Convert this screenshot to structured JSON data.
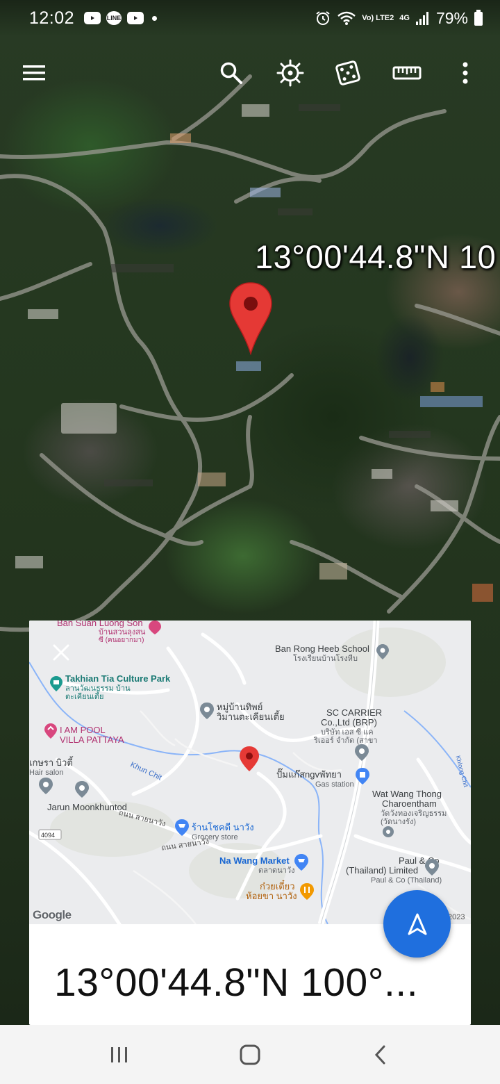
{
  "status_bar": {
    "time": "12:02",
    "notification_icons": [
      "youtube-icon",
      "line-icon",
      "youtube-icon"
    ],
    "battery_percent": "79%",
    "volte_label": "Vo) LTE2",
    "network_label": "4G"
  },
  "toolbar": {
    "icons": [
      "menu-icon",
      "search-icon",
      "voyager-wheel-icon",
      "feeling-lucky-dice-icon",
      "measure-ruler-icon",
      "more-options-icon"
    ]
  },
  "globe": {
    "coordinate_label": "13°00'44.8\"N 10"
  },
  "card": {
    "coordinate_title": "13°00'44.8\"N 100°...",
    "map": {
      "places": [
        {
          "name": "Ban Suan Luong Son",
          "type": "pink"
        },
        {
          "name": "บ้านสวนลุงสน",
          "type": "pink"
        },
        {
          "name": "ซี (คนอยากมา)",
          "type": "pink"
        },
        {
          "name": "Ban Rong Heeb School",
          "type": "dark"
        },
        {
          "name": "โรงเรียนบ้านโรงหีบ",
          "type": "small"
        },
        {
          "name": "Takhian Tia Culture Park",
          "type": "teal"
        },
        {
          "name": "ลานวัฒนธรรม บ้าน",
          "type": "teal-small"
        },
        {
          "name": "ตะเคียนเตี้ย",
          "type": "teal-small"
        },
        {
          "name": "หมู่บ้านทิพย์",
          "type": "dark"
        },
        {
          "name": "วิมานตะเคียนเตี้ย",
          "type": "dark"
        },
        {
          "name": "SC CARRIER",
          "type": "dark"
        },
        {
          "name": "Co.,Ltd (BRP)",
          "type": "dark"
        },
        {
          "name": "บริษัท เอส ซี แค",
          "type": "small"
        },
        {
          "name": "ริเออร์ จำกัด (สาขา",
          "type": "small"
        },
        {
          "name": "I AM POOL",
          "type": "pink"
        },
        {
          "name": "VILLA PATTAYA",
          "type": "pink"
        },
        {
          "name": "เกษรา บิวตี้",
          "type": "dark"
        },
        {
          "name": "Hair salon",
          "type": "small"
        },
        {
          "name": "ปั๊มแก๊สngvพัทยา",
          "type": "dark"
        },
        {
          "name": "Gas station",
          "type": "small"
        },
        {
          "name": "Wat Wang Thong",
          "type": "dark"
        },
        {
          "name": "Charoentham",
          "type": "dark"
        },
        {
          "name": "วัดวังทองเจริญธรรม",
          "type": "small"
        },
        {
          "name": "(วัดนางรัง)",
          "type": "small"
        },
        {
          "name": "Jarun Moonkhuntod",
          "type": "dark"
        },
        {
          "name": "ร้านโชคดี นาวัง",
          "type": "blue"
        },
        {
          "name": "Grocery store",
          "type": "small"
        },
        {
          "name": "Na Wang Market",
          "type": "blue"
        },
        {
          "name": "ตลาดนาวัง",
          "type": "small"
        },
        {
          "name": "Paul & Co",
          "type": "dark"
        },
        {
          "name": "(Thailand) Limited",
          "type": "dark"
        },
        {
          "name": "Paul & Co (Thailand)",
          "type": "small"
        },
        {
          "name": "ก๋วยเตี๋ยว",
          "type": "orange"
        },
        {
          "name": "ห้อยขา นาวัง",
          "type": "orange"
        }
      ],
      "roads": [
        "ถนน สายนาวัง",
        "ถนน สายนาวัง",
        "Khun Chit",
        "Khlong Chit",
        "4094"
      ],
      "logo": "Google",
      "copyright": "2023"
    }
  },
  "nav_fab": {
    "icon": "navigation-arrow-icon"
  },
  "nav_bar": {
    "icons": [
      "recent-apps-icon",
      "home-icon",
      "back-icon"
    ]
  },
  "colors": {
    "pin_red": "#e53935",
    "fab_blue": "#1f6fde"
  }
}
